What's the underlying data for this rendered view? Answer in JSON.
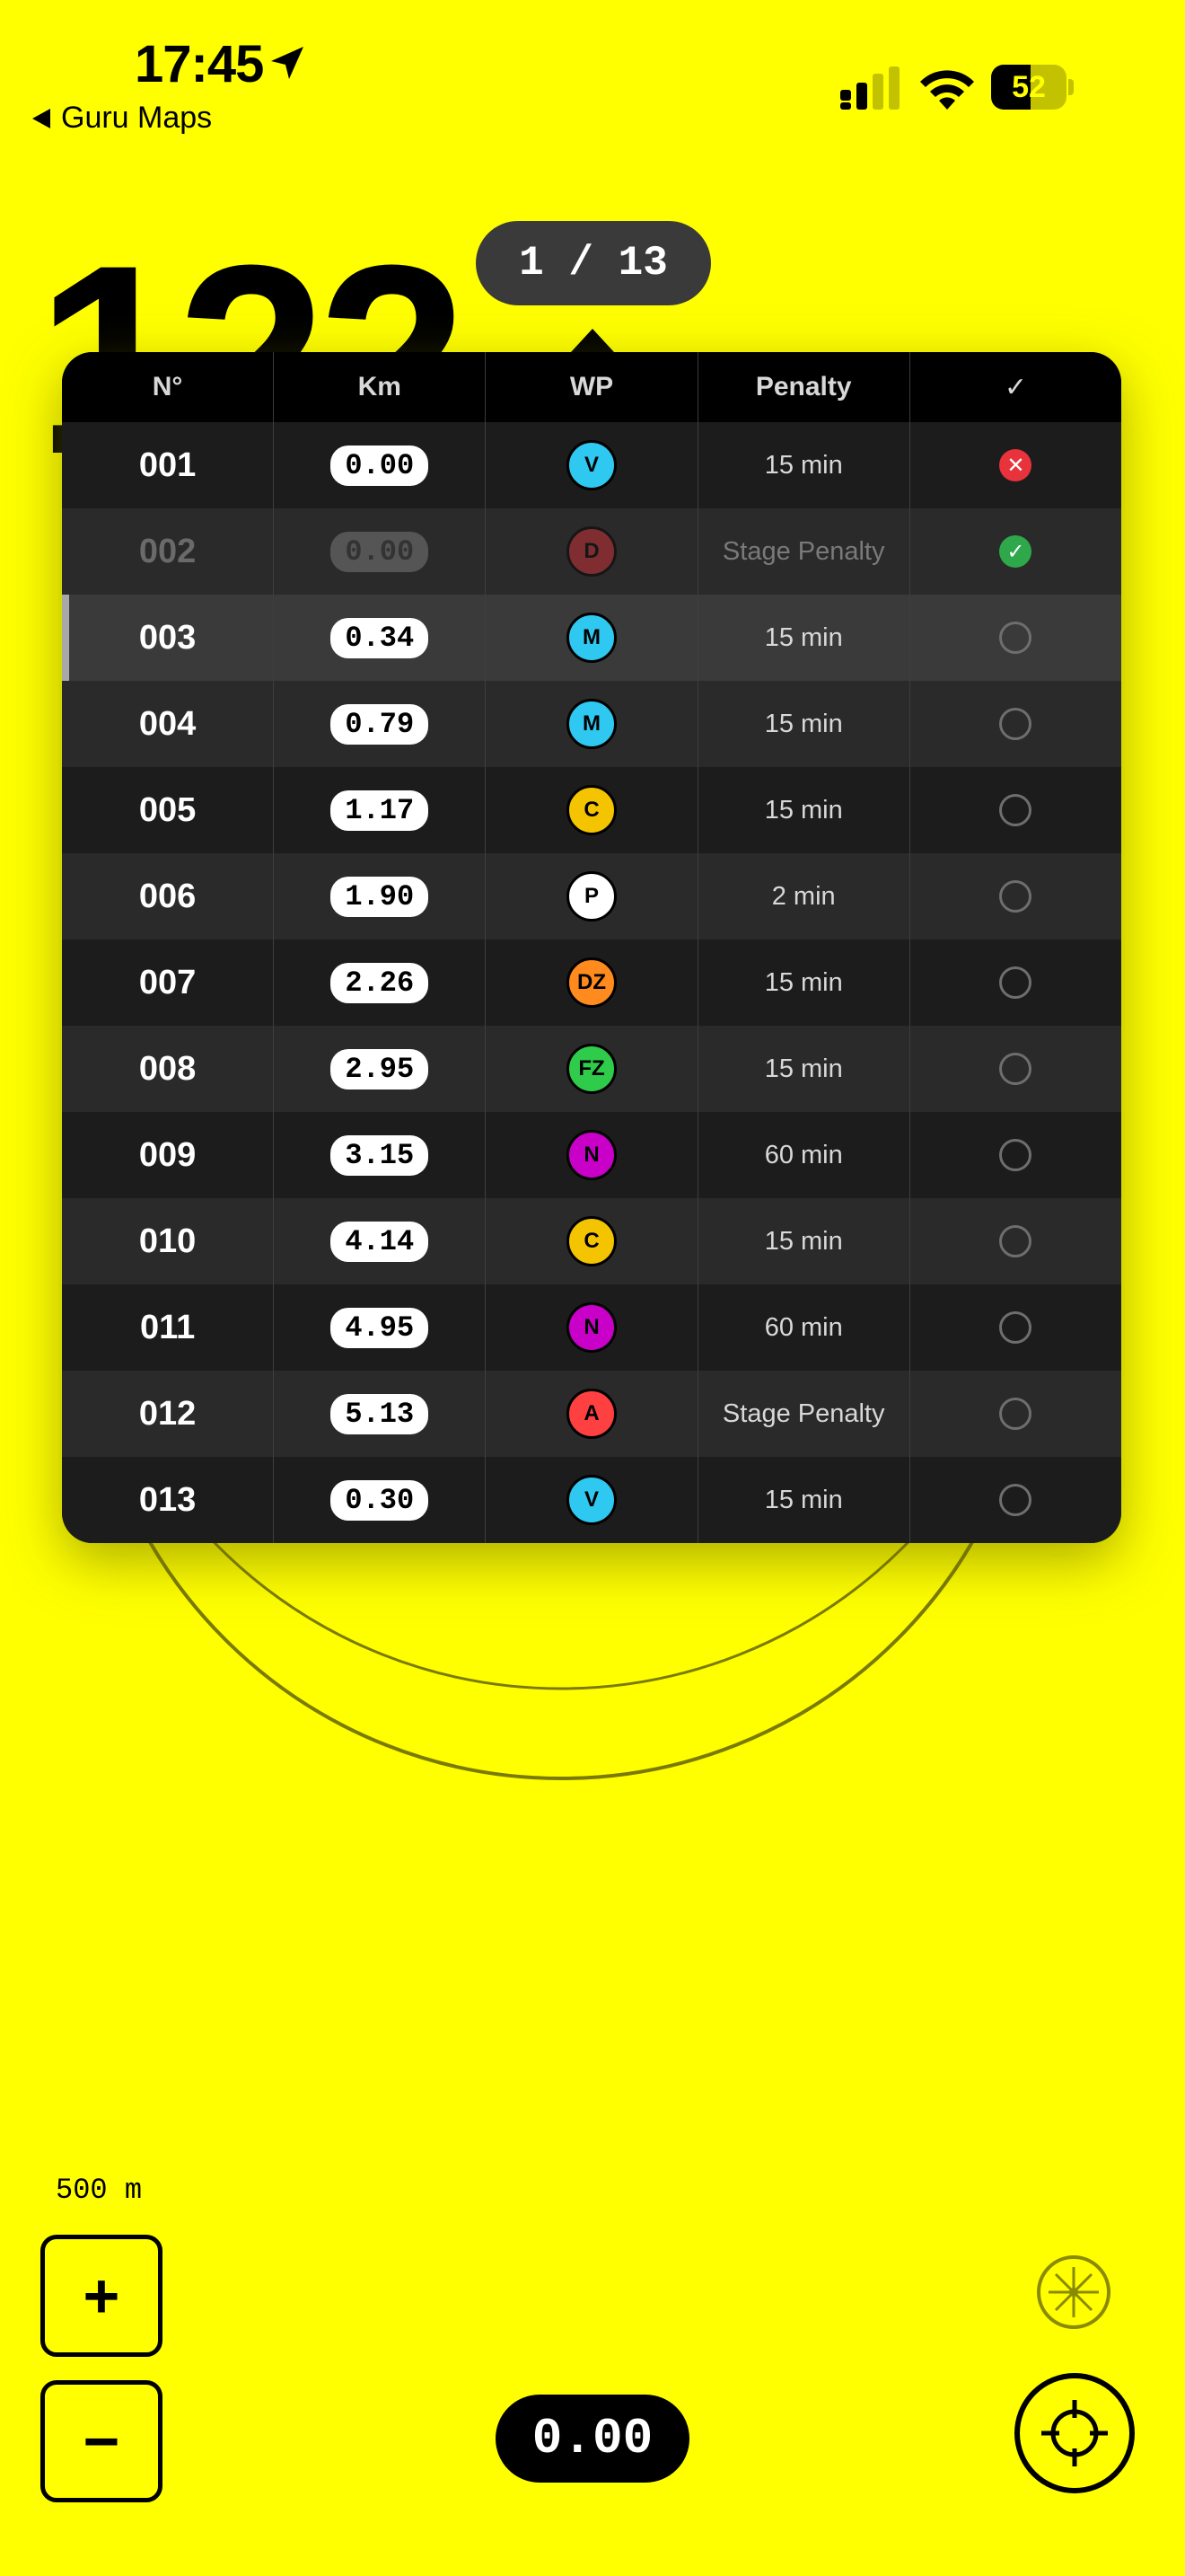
{
  "status_bar": {
    "time": "17:45",
    "back_label": "Guru Maps",
    "battery_level": "52"
  },
  "background_value": "122",
  "pager": {
    "label": "1 / 13"
  },
  "table": {
    "headers": [
      "N°",
      "Km",
      "WP",
      "Penalty",
      "✓"
    ],
    "rows": [
      {
        "no": "001",
        "km": "0.00",
        "wp": "V",
        "wp_color": "#2FC8F0",
        "penalty": "15 min",
        "status": "failed"
      },
      {
        "no": "002",
        "km": "0.00",
        "wp": "D",
        "wp_color": "#E8323C",
        "penalty": "Stage Penalty",
        "status": "done"
      },
      {
        "no": "003",
        "km": "0.34",
        "wp": "M",
        "wp_color": "#2FC8F0",
        "penalty": "15 min",
        "status": "pending"
      },
      {
        "no": "004",
        "km": "0.79",
        "wp": "M",
        "wp_color": "#2FC8F0",
        "penalty": "15 min",
        "status": "pending"
      },
      {
        "no": "005",
        "km": "1.17",
        "wp": "C",
        "wp_color": "#F5C400",
        "penalty": "15 min",
        "status": "pending"
      },
      {
        "no": "006",
        "km": "1.90",
        "wp": "P",
        "wp_color": "#FFFFFF",
        "penalty": "2 min",
        "status": "pending"
      },
      {
        "no": "007",
        "km": "2.26",
        "wp": "DZ",
        "wp_color": "#FF8A1E",
        "penalty": "15 min",
        "status": "pending"
      },
      {
        "no": "008",
        "km": "2.95",
        "wp": "FZ",
        "wp_color": "#2ECC4A",
        "penalty": "15 min",
        "status": "pending"
      },
      {
        "no": "009",
        "km": "3.15",
        "wp": "N",
        "wp_color": "#C800C8",
        "penalty": "60 min",
        "status": "pending"
      },
      {
        "no": "010",
        "km": "4.14",
        "wp": "C",
        "wp_color": "#F5C400",
        "penalty": "15 min",
        "status": "pending"
      },
      {
        "no": "011",
        "km": "4.95",
        "wp": "N",
        "wp_color": "#C800C8",
        "penalty": "60 min",
        "status": "pending"
      },
      {
        "no": "012",
        "km": "5.13",
        "wp": "A",
        "wp_color": "#FF4040",
        "penalty": "Stage Penalty",
        "status": "pending"
      },
      {
        "no": "013",
        "km": "0.30",
        "wp": "V",
        "wp_color": "#2FC8F0",
        "penalty": "15 min",
        "status": "pending"
      }
    ]
  },
  "map": {
    "scale_label": "500 m",
    "zoom_in_label": "+",
    "zoom_out_label": "−",
    "odometer": "0.00"
  },
  "colors": {
    "background": "#FFFF00",
    "panel": "#000000"
  }
}
